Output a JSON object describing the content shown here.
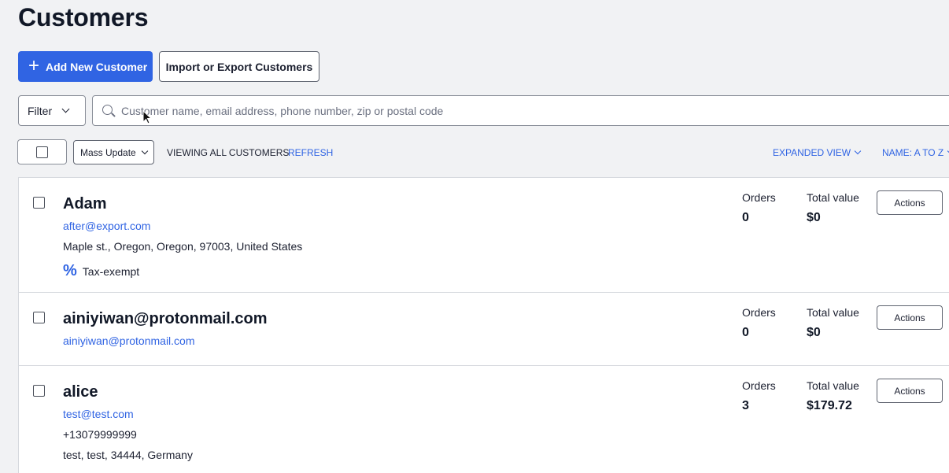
{
  "page_title": "Customers",
  "toolbar": {
    "add_label": "Add New Customer",
    "import_export_label": "Import or Export Customers"
  },
  "filter_label": "Filter",
  "search": {
    "placeholder": "Customer name, email address, phone number, zip or postal code"
  },
  "list_controls": {
    "mass_update_label": "Mass Update",
    "viewing_text": "VIEWING ALL CUSTOMERS",
    "refresh_label": "REFRESH",
    "view_mode_label": "EXPANDED VIEW",
    "sort_label": "NAME: A TO Z"
  },
  "customers": [
    {
      "name": "Adam",
      "email": "after@export.com",
      "address": "Maple st., Oregon, Oregon, 97003, United States",
      "tax_label": "Tax-exempt",
      "orders_label": "Orders",
      "orders": "0",
      "total_label": "Total value",
      "total": "$0",
      "actions_label": "Actions"
    },
    {
      "name": "ainiyiwan@protonmail.com",
      "email": "ainiyiwan@protonmail.com",
      "orders_label": "Orders",
      "orders": "0",
      "total_label": "Total value",
      "total": "$0",
      "actions_label": "Actions"
    },
    {
      "name": "alice",
      "email": "test@test.com",
      "phone": "+13079999999",
      "address": "test, test, 34444, Germany",
      "orders_label": "Orders",
      "orders": "3",
      "total_label": "Total value",
      "total": "$179.72",
      "actions_label": "Actions"
    }
  ],
  "colors": {
    "accent": "#3064e3",
    "background": "#f1f2f4",
    "text": "#1c2030"
  },
  "icons": [
    "plus-icon",
    "chevron-down-icon",
    "search-icon",
    "percent-icon",
    "mouse-cursor-icon"
  ]
}
